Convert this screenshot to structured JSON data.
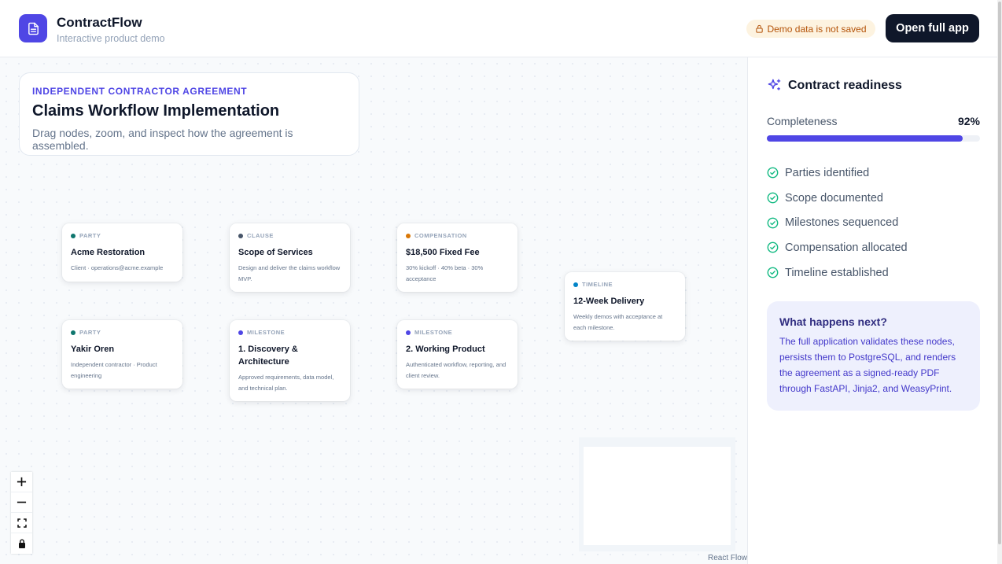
{
  "header": {
    "app_name": "ContractFlow",
    "subtitle": "Interactive product demo",
    "demo_badge": "Demo data is not saved",
    "open_button": "Open full app"
  },
  "canvas": {
    "title_card": {
      "eyebrow": "INDEPENDENT CONTRACTOR AGREEMENT",
      "title": "Claims Workflow Implementation",
      "description": "Drag nodes, zoom, and inspect how the agreement is assembled."
    },
    "nodes": [
      {
        "type": "PARTY",
        "color": "#0f766e",
        "title": "Acme Restoration",
        "desc": "Client · operations@acme.example"
      },
      {
        "type": "CLAUSE",
        "color": "#475569",
        "title": "Scope of Services",
        "desc": "Design and deliver the claims workflow MVP."
      },
      {
        "type": "COMPENSATION",
        "color": "#d97706",
        "title": "$18,500 Fixed Fee",
        "desc": "30% kickoff · 40% beta · 30% acceptance"
      },
      {
        "type": "TIMELINE",
        "color": "#0284c7",
        "title": "12-Week Delivery",
        "desc": "Weekly demos with acceptance at each milestone."
      },
      {
        "type": "PARTY",
        "color": "#0f766e",
        "title": "Yakir Oren",
        "desc": "Independent contractor · Product engineering"
      },
      {
        "type": "MILESTONE",
        "color": "#4f46e5",
        "title": "1. Discovery & Architecture",
        "desc": "Approved requirements, data model, and technical plan."
      },
      {
        "type": "MILESTONE",
        "color": "#4f46e5",
        "title": "2. Working Product",
        "desc": "Authenticated workflow, reporting, and client review."
      }
    ],
    "attribution": "React Flow",
    "controls": [
      "zoom-in",
      "zoom-out",
      "fit-view",
      "lock"
    ]
  },
  "panel": {
    "title": "Contract readiness",
    "completeness_label": "Completeness",
    "completeness_value": "92%",
    "completeness_fraction": 0.92,
    "checklist": [
      "Parties identified",
      "Scope documented",
      "Milestones sequenced",
      "Compensation allocated",
      "Timeline established"
    ],
    "next": {
      "heading": "What happens next?",
      "body": "The full application validates these nodes, persists them to PostgreSQL, and renders the agreement as a signed-ready PDF through FastAPI, Jinja2, and WeasyPrint."
    }
  },
  "colors": {
    "accent": "#4f46e5",
    "success": "#10b981",
    "warning": "#b45309"
  }
}
